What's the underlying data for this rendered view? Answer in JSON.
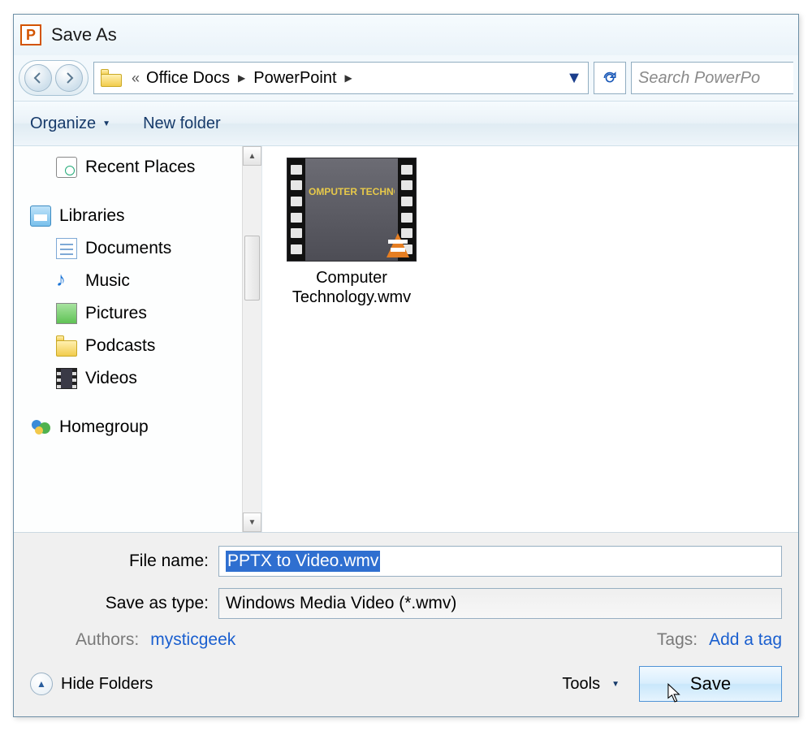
{
  "window": {
    "title": "Save As"
  },
  "nav": {
    "back": "back",
    "forward": "forward",
    "crumb_prefix": "«",
    "crumbs": [
      "Office Docs",
      "PowerPoint"
    ],
    "arrow": "▶",
    "dropdown": "▼",
    "refresh": "refresh",
    "search_placeholder": "Search PowerPo"
  },
  "toolbar": {
    "organize": "Organize",
    "organize_drop": "▼",
    "new_folder": "New folder"
  },
  "tree": {
    "recent": "Recent Places",
    "libraries": "Libraries",
    "documents": "Documents",
    "music": "Music",
    "pictures": "Pictures",
    "podcasts": "Podcasts",
    "videos": "Videos",
    "homegroup": "Homegroup"
  },
  "files": {
    "item1": {
      "line1": "Computer",
      "line2": "Technology.wmv",
      "thumb_text": "OMPUTER TECHNOLOG"
    }
  },
  "fields": {
    "file_name_label": "File name:",
    "file_name_value": "PPTX to Video.wmv",
    "type_label": "Save as type:",
    "type_value": "Windows Media Video (*.wmv)"
  },
  "meta": {
    "authors_label": "Authors:",
    "authors_value": "mysticgeek",
    "tags_label": "Tags:",
    "tags_value": "Add a tag"
  },
  "footer": {
    "hide_folders": "Hide Folders",
    "caret": "▲",
    "tools": "Tools",
    "tools_drop": "▼",
    "save": "Save"
  }
}
